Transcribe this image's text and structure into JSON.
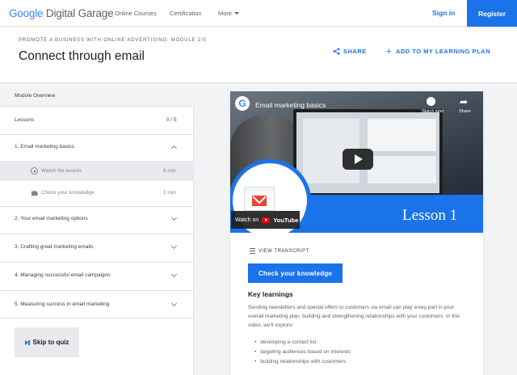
{
  "nav": {
    "logo_google": "Google",
    "logo_product": "Digital Garage",
    "links": [
      "Online Courses",
      "Certification",
      "More"
    ],
    "signin": "Sign in",
    "register": "Register"
  },
  "header": {
    "kicker": "PROMOTE A BUSINESS WITH ONLINE ADVERTISING: MODULE 2/5",
    "title": "Connect through email",
    "share": "SHARE",
    "add_plan": "ADD TO MY LEARNING PLAN"
  },
  "sidebar": {
    "overview": "Module Overview",
    "lessons_label": "Lessons",
    "lessons_count": "0 / 5",
    "items": [
      {
        "label": "1. Email marketing basics",
        "expanded": true
      },
      {
        "label": "2. Your email marketing options",
        "expanded": false
      },
      {
        "label": "3. Crafting great marketing emails",
        "expanded": false
      },
      {
        "label": "4. Managing successful email campaigns",
        "expanded": false
      },
      {
        "label": "5. Measuring success in email marketing",
        "expanded": false
      }
    ],
    "sub_items": [
      {
        "label": "Watch the lesson",
        "duration": "6 min",
        "icon": "play-circle-icon",
        "active": true
      },
      {
        "label": "Check your knowledge",
        "duration": "1 min",
        "icon": "puzzle-icon",
        "active": false
      }
    ],
    "skip": "Skip to quiz"
  },
  "video": {
    "title": "Email marketing basics",
    "watch_later": "Watch later",
    "share": "Share",
    "lesson_label": "Lesson 1",
    "watch_on": "Watch on",
    "youtube": "YouTube"
  },
  "content": {
    "transcript": "VIEW TRANSCRIPT",
    "check_button": "Check your knowledge",
    "key_title": "Key learnings",
    "key_body": "Sending newsletters and special offers to customers via email can play a key part in your overall marketing plan, building and strengthening relationships with your customers. In this video, we'll explore:",
    "bullets": [
      "developing a contact list",
      "targeting audiences based on interests",
      "building relationships with customers"
    ]
  },
  "colors": {
    "accent": "#1a73e8",
    "gmail_red": "#ea4335",
    "panel_bg": "#f1f3f4"
  }
}
